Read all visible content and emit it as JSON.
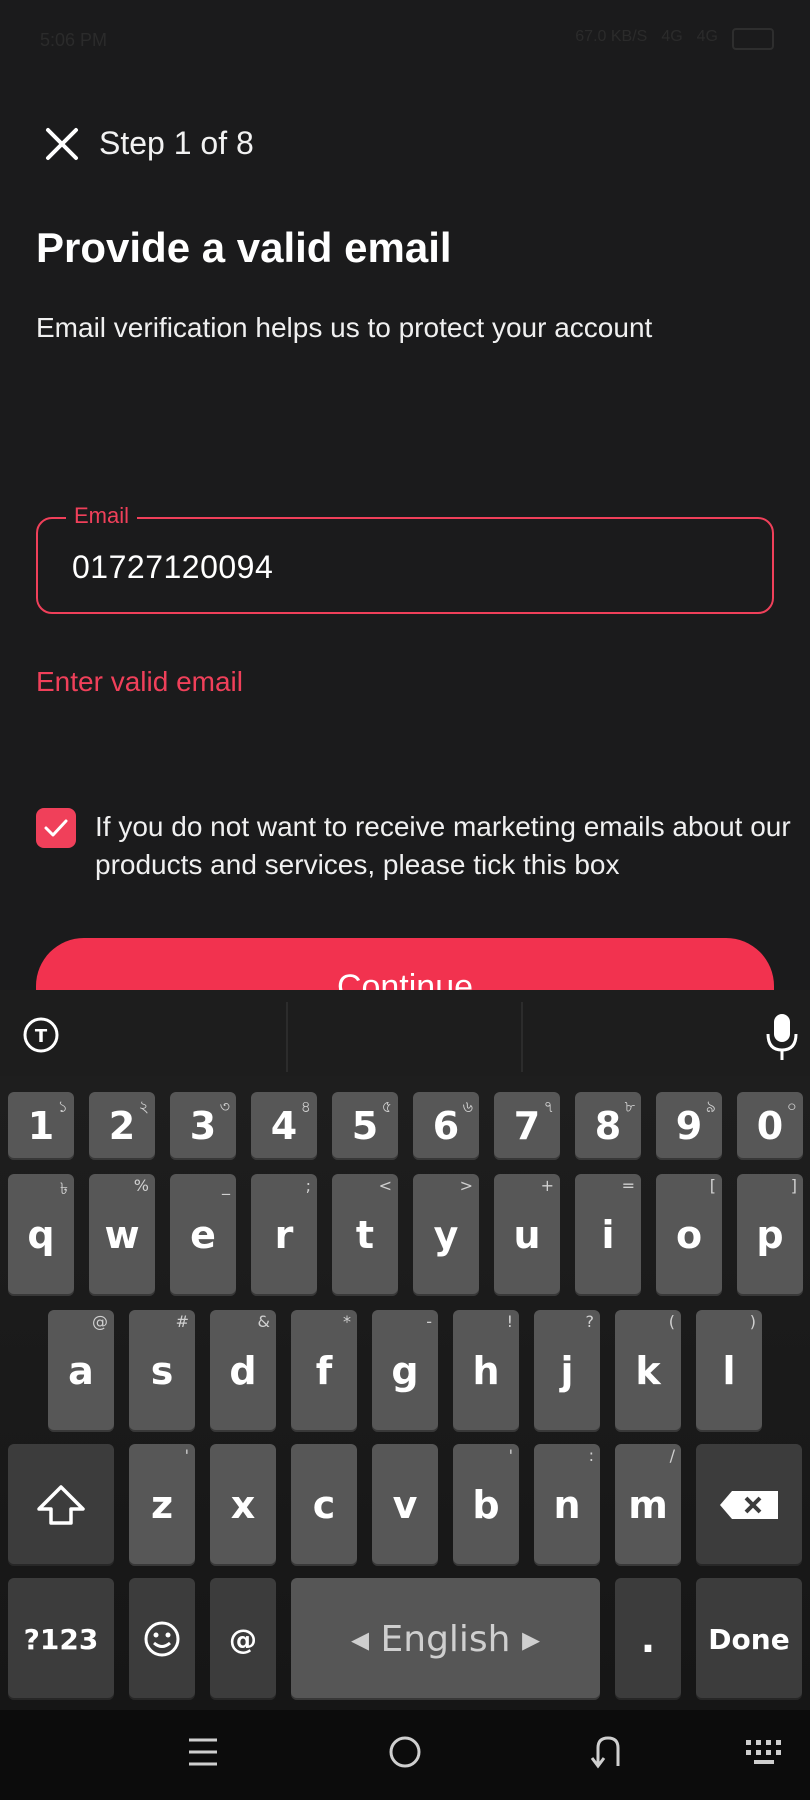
{
  "status_bar": {
    "time": "5:06 PM",
    "net_speed": "67.0 KB/S",
    "signal_1": "4G",
    "signal_2": "4G",
    "battery": "63"
  },
  "header": {
    "close_icon": "close-icon",
    "step_label": "Step 1 of 8"
  },
  "content": {
    "title": "Provide a valid email",
    "subtitle": "Email verification helps us to protect your account"
  },
  "email_field": {
    "label": "Email",
    "value": "01727120094",
    "error": "Enter valid email"
  },
  "marketing_opt_out": {
    "checked": true,
    "text": "If you do not want to receive marketing emails about our products and services, please tick this box"
  },
  "continue_button": {
    "label": "Continue"
  },
  "keyboard": {
    "row_numbers": [
      {
        "key": "1",
        "hint": "১"
      },
      {
        "key": "2",
        "hint": "২"
      },
      {
        "key": "3",
        "hint": "৩"
      },
      {
        "key": "4",
        "hint": "৪"
      },
      {
        "key": "5",
        "hint": "৫"
      },
      {
        "key": "6",
        "hint": "৬"
      },
      {
        "key": "7",
        "hint": "৭"
      },
      {
        "key": "8",
        "hint": "৮"
      },
      {
        "key": "9",
        "hint": "৯"
      },
      {
        "key": "0",
        "hint": "০"
      }
    ],
    "row_1": [
      {
        "key": "q",
        "hint": "৳"
      },
      {
        "key": "w",
        "hint": "%"
      },
      {
        "key": "e",
        "hint": "_"
      },
      {
        "key": "r",
        "hint": ";"
      },
      {
        "key": "t",
        "hint": "<"
      },
      {
        "key": "y",
        "hint": ">"
      },
      {
        "key": "u",
        "hint": "+"
      },
      {
        "key": "i",
        "hint": "="
      },
      {
        "key": "o",
        "hint": "["
      },
      {
        "key": "p",
        "hint": "]"
      }
    ],
    "row_2": [
      {
        "key": "a",
        "hint": "@"
      },
      {
        "key": "s",
        "hint": "#"
      },
      {
        "key": "d",
        "hint": "&"
      },
      {
        "key": "f",
        "hint": "*"
      },
      {
        "key": "g",
        "hint": "-"
      },
      {
        "key": "h",
        "hint": "!"
      },
      {
        "key": "j",
        "hint": "?"
      },
      {
        "key": "k",
        "hint": "("
      },
      {
        "key": "l",
        "hint": ")"
      }
    ],
    "row_3": [
      {
        "key": "z",
        "hint": "'"
      },
      {
        "key": "x",
        "hint": ""
      },
      {
        "key": "c",
        "hint": ""
      },
      {
        "key": "v",
        "hint": ""
      },
      {
        "key": "b",
        "hint": "'"
      },
      {
        "key": "n",
        "hint": ":"
      },
      {
        "key": "m",
        "hint": "/"
      }
    ],
    "symbols_key": "?123",
    "at_key": "@",
    "space_label": "English",
    "period_key": ".",
    "done_key": "Done"
  },
  "nav_bar": {
    "menu_icon": "menu-icon",
    "home_icon": "home-icon",
    "back_icon": "back-icon",
    "keyboard_icon": "keyboard-icon"
  }
}
